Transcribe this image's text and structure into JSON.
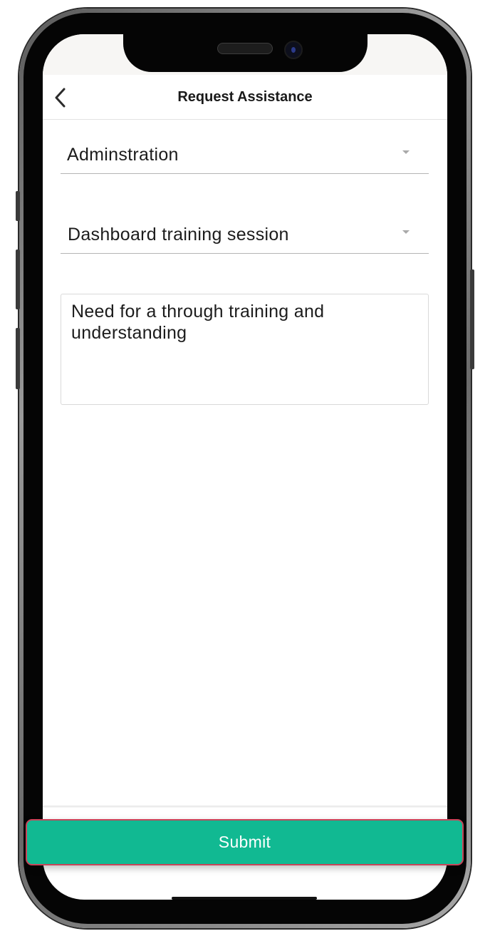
{
  "header": {
    "title": "Request Assistance",
    "back_icon": "chevron-left-icon"
  },
  "form": {
    "category": {
      "value": "Adminstration",
      "icon": "caret-down-icon"
    },
    "topic": {
      "value": "Dashboard training session",
      "icon": "caret-down-icon"
    },
    "description": {
      "value": "Need for a through training and understanding"
    }
  },
  "actions": {
    "submit_label": "Submit"
  },
  "colors": {
    "submit_bg": "#11b992",
    "submit_border": "#c9455a",
    "text": "#1c1c1c",
    "divider": "#b5b5b5"
  }
}
